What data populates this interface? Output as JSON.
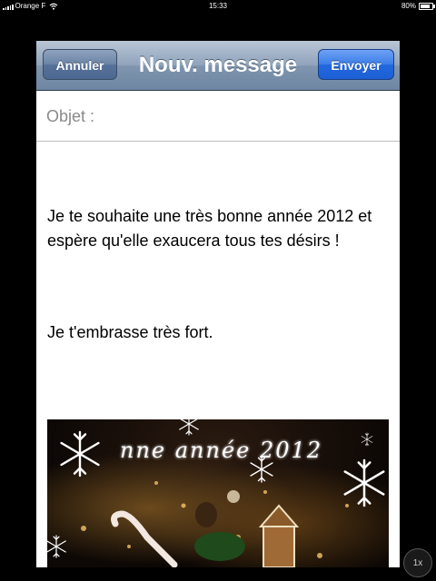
{
  "status_bar": {
    "carrier": "Orange F",
    "time": "15:33",
    "battery": "80%",
    "battery_level": 0.8
  },
  "compose": {
    "title": "Nouv. message",
    "cancel_label": "Annuler",
    "send_label": "Envoyer",
    "subject_label": "Objet :",
    "subject_value": "",
    "body_paragraphs": [
      "Je te souhaite une très bonne année 2012 et espère qu'elle exaucera tous tes désirs !",
      "Je t'embrasse très fort."
    ],
    "image_caption": "nne année 2012"
  },
  "zoom_button": {
    "label": "1x"
  },
  "colors": {
    "nav_bar": "#8fa3bb",
    "send_button": "#2168e0",
    "cancel_button": "#56729a"
  },
  "icons": [
    "signal-bars-icon",
    "wifi-icon",
    "battery-icon",
    "snowflake-icon"
  ]
}
